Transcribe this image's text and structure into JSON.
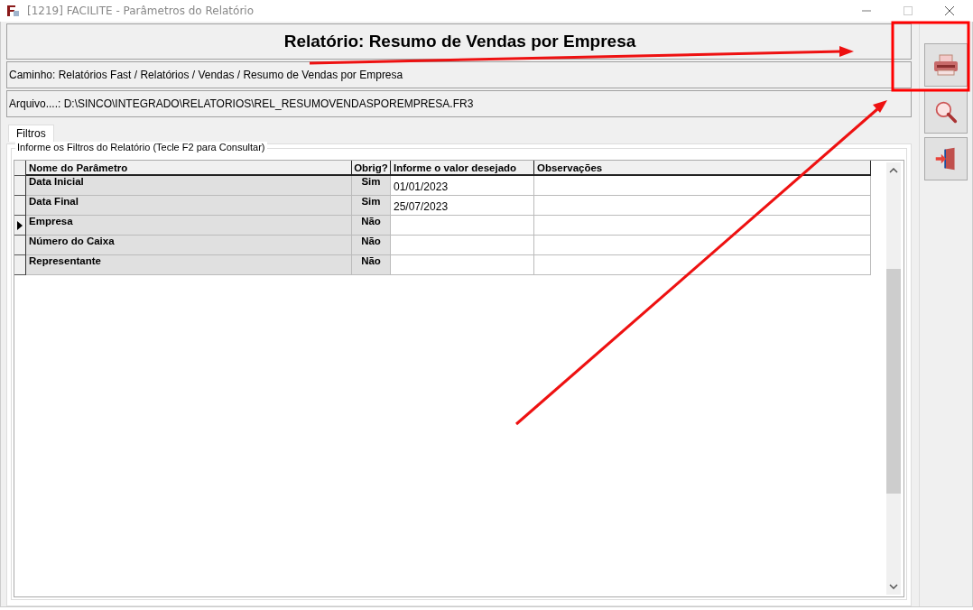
{
  "window": {
    "title": "[1219] FACILITE - Parâmetros do Relatório"
  },
  "header": {
    "title": "Relatório: Resumo de Vendas por Empresa",
    "path": "Caminho: Relatórios Fast / Relatórios / Vendas / Resumo de Vendas por Empresa",
    "file": "Arquivo....: D:\\SINCO\\INTEGRADO\\RELATORIOS\\REL_RESUMOVENDASPOREMPRESA.FR3"
  },
  "tabs": [
    {
      "label": "Filtros",
      "selected": true
    }
  ],
  "group": {
    "title": "Informe os Filtros do Relatório (Tecle F2 para Consultar)"
  },
  "table": {
    "columns": [
      "Nome do Parâmetro",
      "Obrig?",
      "Informe o valor desejado",
      "Observações"
    ],
    "rows": [
      {
        "name": "Data Inicial",
        "required": "Sim",
        "value": "01/01/2023",
        "selected": false
      },
      {
        "name": "Data Final",
        "required": "Sim",
        "value": "25/07/2023",
        "selected": false
      },
      {
        "name": "Empresa",
        "required": "Não",
        "selected": true
      },
      {
        "name": "Número do Caixa",
        "required": "Não",
        "selected": false
      },
      {
        "name": "Representante",
        "required": "Não",
        "selected": false
      }
    ]
  },
  "toolbar": [
    {
      "kind": "print"
    },
    {
      "kind": "preview"
    },
    {
      "kind": "exit"
    }
  ]
}
